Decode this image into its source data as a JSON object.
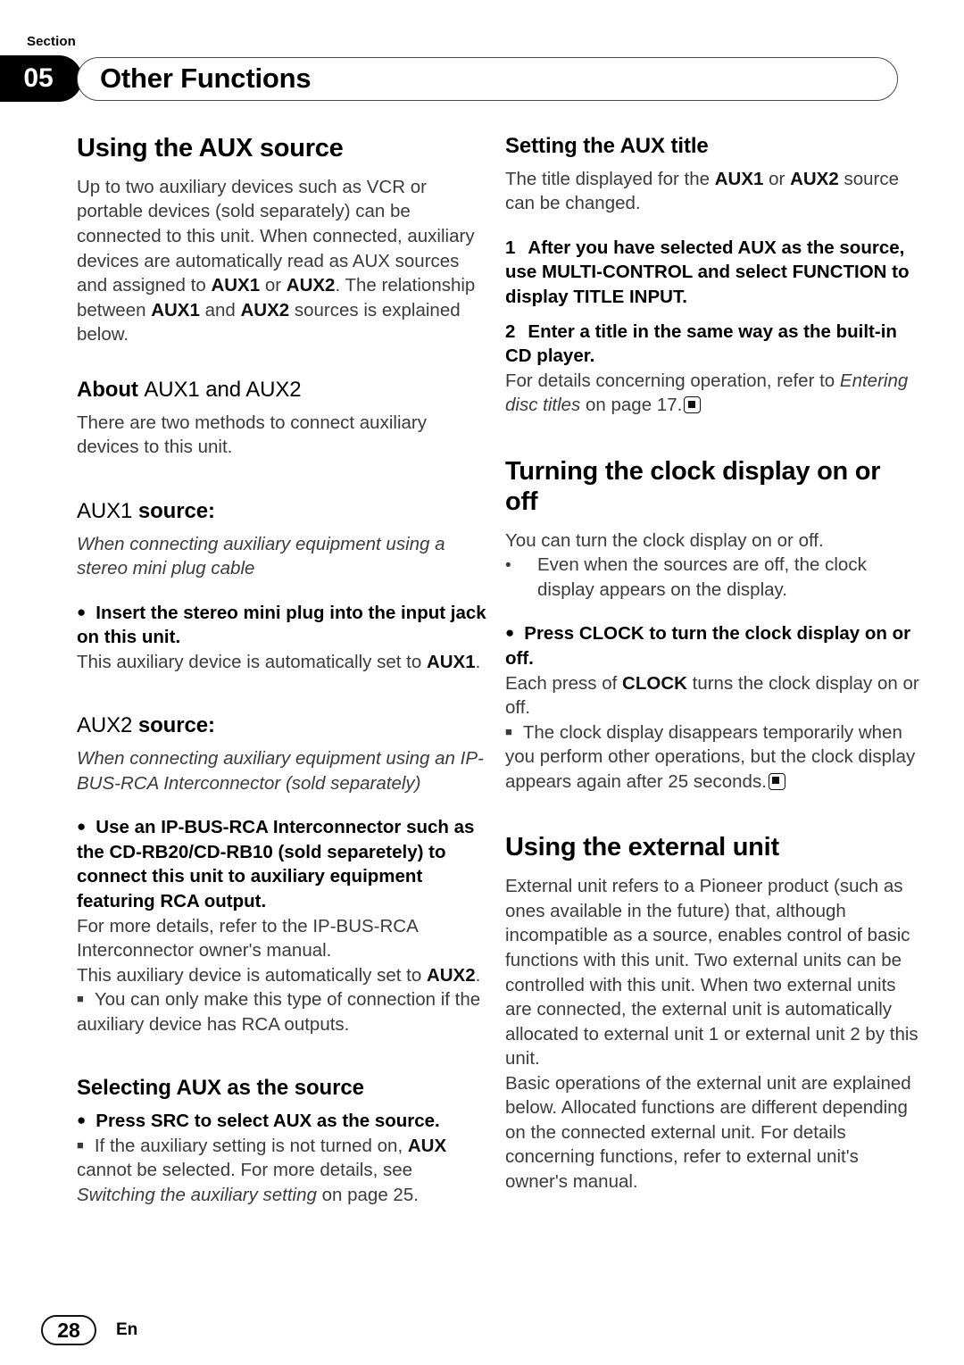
{
  "header": {
    "kicker": "Section",
    "section_number": "05",
    "title": "Other Functions"
  },
  "left_column": {
    "heading_using_aux": "Using the AUX source",
    "intro_p1_a": "Up to two auxiliary devices such as VCR or portable devices (sold separately) can be connected to this unit. When connected, auxiliary devices are automatically read as AUX sources and assigned to ",
    "intro_aux1": "AUX1",
    "intro_or": " or ",
    "intro_aux2": "AUX2",
    "intro_p1_b": ". The relationship between ",
    "intro_aux1_b": "AUX1",
    "intro_and": " and ",
    "intro_aux2_b": "AUX2",
    "intro_p1_c": " sources is explained below.",
    "heading_about_bold": "About ",
    "heading_about_light": "AUX1 and AUX2",
    "about_body": "There are two methods to connect auxiliary devices to this unit.",
    "heading_aux1_light": "AUX1",
    "heading_aux1_bold": " source:",
    "aux1_italic": "When connecting auxiliary equipment using a stereo mini plug cable",
    "aux1_action_bullet": "●",
    "aux1_action": "Insert the stereo mini plug into the input jack on this unit.",
    "aux1_note_a": "This auxiliary device is automatically set to ",
    "aux1_note_b": "AUX1",
    "aux1_note_c": ".",
    "heading_aux2_light": "AUX2",
    "heading_aux2_bold": " source:",
    "aux2_italic": "When connecting auxiliary equipment using an IP-BUS-RCA Interconnector (sold separately)",
    "aux2_action_bullet": "●",
    "aux2_action": "Use an IP-BUS-RCA Interconnector such as the CD-RB20/CD-RB10 (sold separetely) to connect this unit to auxiliary equipment featuring RCA output.",
    "aux2_body1": "For more details, refer to the IP-BUS-RCA Interconnector owner's manual.",
    "aux2_body2_a": "This auxiliary device is automatically set to ",
    "aux2_body2_b": "AUX2",
    "aux2_body2_c": ".",
    "aux2_note_bullet": "■",
    "aux2_note": "You can only make this type of connection if the auxiliary device has RCA outputs.",
    "heading_selecting": "Selecting AUX as the source",
    "selecting_action_bullet": "●",
    "selecting_action": "Press SRC to select AUX as the source.",
    "selecting_note_bullet": "■",
    "selecting_note_a": "If the auxiliary setting is not turned on, ",
    "selecting_note_b": "AUX",
    "selecting_note_c": " cannot be selected. For more details, see ",
    "selecting_note_italic": "Switching the auxiliary setting",
    "selecting_note_d": " on page 25."
  },
  "right_column": {
    "heading_setting_title": "Setting the AUX title",
    "setting_body_a": "The title displayed for the ",
    "setting_aux1": "AUX1",
    "setting_or": " or ",
    "setting_aux2": "AUX2",
    "setting_body_b": " source can be changed.",
    "step1_num": "1",
    "step1_text": "After you have selected AUX as the source, use MULTI-CONTROL and select FUNCTION to display TITLE INPUT.",
    "step2_num": "2",
    "step2_text": "Enter a title in the same way as the built-in CD player.",
    "step2_body_a": "For details concerning operation, refer to ",
    "step2_body_italic": "Entering disc titles",
    "step2_body_b": " on page 17.",
    "heading_clock": "Turning the clock display on or off",
    "clock_body": "You can turn the clock display on or off.",
    "clock_dot_bullet": "•",
    "clock_dot_text": "Even when the sources are off, the clock display appears on the display.",
    "clock_action_bullet": "●",
    "clock_action": "Press CLOCK to turn the clock display on or off.",
    "clock_after_a": "Each press of ",
    "clock_after_b": "CLOCK",
    "clock_after_c": " turns the clock display on or off.",
    "clock_note_bullet": "■",
    "clock_note": "The clock display disappears temporarily when you perform other operations, but the clock display appears again after 25 seconds.",
    "heading_external": "Using the external unit",
    "external_body1": "External unit refers to a Pioneer product (such as ones available in the future) that, although incompatible as a source, enables control of basic functions with this unit. Two external units can be controlled with this unit. When two external units are connected, the external unit is automatically allocated to external unit 1 or external unit 2 by this unit.",
    "external_body2": "Basic operations of the external unit are explained below. Allocated functions are different depending on the connected external unit. For details concerning functions, refer to external unit's owner's manual."
  },
  "footer": {
    "page_number": "28",
    "language": "En"
  }
}
